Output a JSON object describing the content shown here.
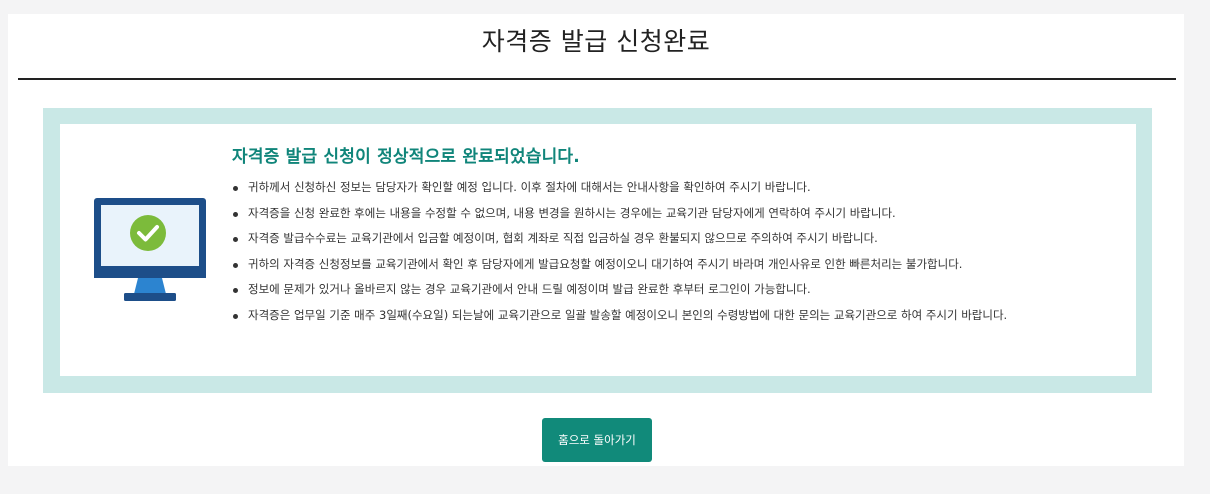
{
  "page": {
    "title": "자격증 발급 신청완료"
  },
  "result": {
    "heading": "자격증 발급 신청이 정상적으로 완료되었습니다.",
    "icon": "monitor-check-icon",
    "notices": [
      "귀하께서 신청하신 정보는 담당자가 확인할 예정 입니다. 이후 절차에 대해서는 안내사항을 확인하여 주시기 바랍니다.",
      "자격증을 신청 완료한 후에는 내용을 수정할 수 없으며, 내용 변경을 원하시는 경우에는 교육기관 담당자에게 연락하여 주시기 바랍니다.",
      "자격증 발급수수료는 교육기관에서 입금할 예정이며, 협회 계좌로 직접 입금하실 경우 환불되지 않으므로 주의하여 주시기 바랍니다.",
      "귀하의 자격증 신청정보를 교육기관에서 확인 후 담당자에게 발급요청할 예정이오니 대기하여 주시기 바라며 개인사유로 인한 빠른처리는 불가합니다.",
      "정보에 문제가 있거나 올바르지 않는 경우 교육기관에서 안내 드릴 예정이며 발급 완료한 후부터 로그인이 가능합니다.",
      "자격증은 업무일 기준 매주 3일째(수요일) 되는날에 교육기관으로 일괄 발송할 예정이오니 본인의 수령방법에 대한 문의는 교육기관으로 하여 주시기 바랍니다."
    ]
  },
  "actions": {
    "home_label": "홈으로 돌아가기"
  },
  "colors": {
    "accent": "#118a7a",
    "heading": "#10857a",
    "box_border": "#c9e8e6",
    "monitor_frame": "#1d4e89",
    "monitor_screen": "#e9f3fb",
    "monitor_stand": "#2c84d0",
    "check_circle": "#7cbb3b"
  }
}
